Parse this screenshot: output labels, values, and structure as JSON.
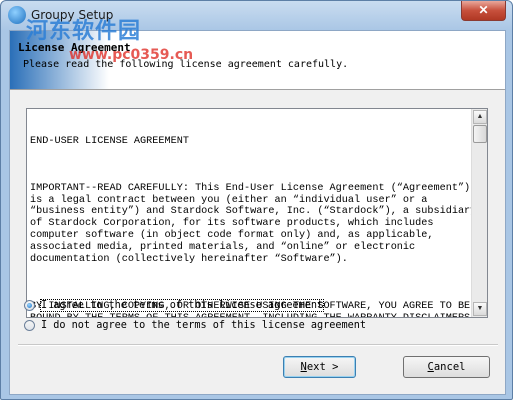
{
  "window": {
    "title": "Groupy Setup",
    "close_label": "✕"
  },
  "watermark": {
    "text": "河东软件园",
    "url": "www.pc0359.cn"
  },
  "header": {
    "title": "License Agreement",
    "subtitle": "Please read the following license agreement carefully."
  },
  "license": {
    "paragraphs": [
      "END-USER LICENSE AGREEMENT",
      "IMPORTANT--READ CAREFULLY: This End-User License Agreement (“Agreement”)\nis a legal contract between you (either an “individual user” or a\n“business entity”) and Stardock Software, Inc. (“Stardock”), a subsidiary\nof Stardock Corporation, for its software products, which includes\ncomputer software (in object code format only) and, as applicable,\nassociated media, printed materials, and “online” or electronic\ndocumentation (collectively hereinafter “Software”).",
      "BY INSTALLING, COPYING, OR OTHERWISE USING THE SOFTWARE, YOU AGREE TO BE\nBOUND BY THE TERMS OF THIS AGREEMENT, INCLUDING THE WARRANTY DISCLAIMERS,\nLIMITATIONS OF LIABILITY AND TERMINATION PROVISIONS BELOW. IF YOU DO NOT\nAGREE TO THE TERMS OF THIS AGREEMENT, DO NOT INSTALL OR USE THE SOFTWARE,"
    ]
  },
  "options": {
    "agree": "I agree to the terms of this license agreement",
    "disagree": "I do not agree to the terms of this license agreement",
    "selected": "agree"
  },
  "buttons": {
    "next_accel": "N",
    "next_rest": "ext >",
    "cancel_accel": "C",
    "cancel_rest": "ancel"
  }
}
